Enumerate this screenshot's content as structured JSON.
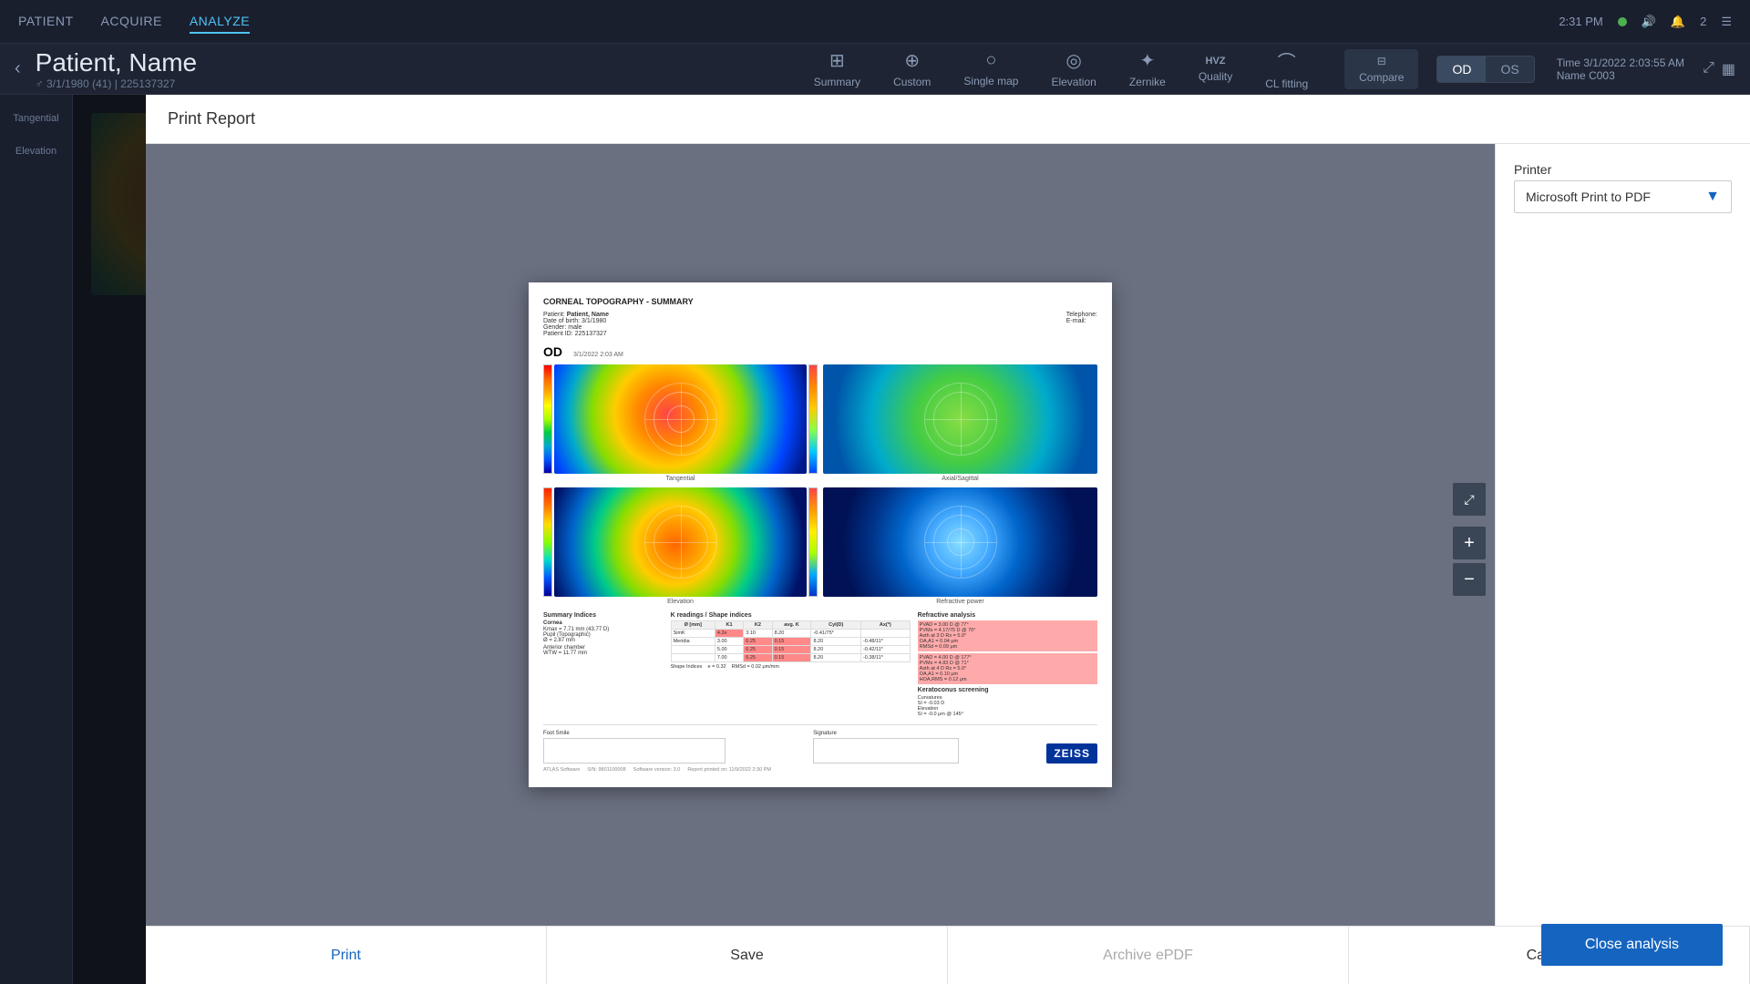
{
  "topNav": {
    "tabs": [
      {
        "label": "PATIENT",
        "active": false
      },
      {
        "label": "ACQUIRE",
        "active": false
      },
      {
        "label": "ANALYZE",
        "active": true
      }
    ],
    "time": "2:31 PM",
    "statusDot": "online",
    "notifCount": "2"
  },
  "toolbar": {
    "backLabel": "‹",
    "patientName": "Patient, Name",
    "patientInfo": "♂ 3/1/1980 (41) | 225137327",
    "tabs": [
      {
        "label": "Summary",
        "icon": "⊞",
        "active": false
      },
      {
        "label": "Custom",
        "icon": "⊕",
        "active": false
      },
      {
        "label": "Single map",
        "icon": "○",
        "active": false
      },
      {
        "label": "Elevation",
        "icon": "◎",
        "active": false
      },
      {
        "label": "Zernike",
        "icon": "✦",
        "active": false
      },
      {
        "label": "Quality",
        "icon": "HVZ",
        "active": false
      },
      {
        "label": "CL fitting",
        "icon": "⌒",
        "active": false
      }
    ],
    "compareLabel": "Compare",
    "odLabel": "OD",
    "osLabel": "OS",
    "time": "Time",
    "timeValue": "3/1/2022 2:03:55 AM",
    "nameLabel": "Name",
    "nameValue": "C003"
  },
  "modal": {
    "title": "Print Report",
    "printerLabel": "Printer",
    "printerValue": "Microsoft Print to PDF",
    "document": {
      "title": "CORNEAL TOPOGRAPHY - SUMMARY",
      "patientLabel": "Patient:",
      "patientName": "Patient, Name",
      "dobLabel": "Date of birth:",
      "dob": "3/1/1980",
      "genderLabel": "Gender:",
      "gender": "male",
      "idLabel": "Patient ID:",
      "id": "225137327",
      "telephoneLabel": "Telephone:",
      "emailLabel": "E-mail:",
      "odLabel": "OD",
      "timestamp": "3/1/2022 2:03 AM",
      "maps": [
        {
          "label": "Tangential",
          "type": "tangential"
        },
        {
          "label": "",
          "type": "small-top"
        },
        {
          "label": "Elevation",
          "type": "elevation"
        },
        {
          "label": "Refractive power",
          "type": "refractive"
        }
      ],
      "summaryTitle": "Summary Indices",
      "cornea": "Cornea",
      "kmax": "Kmax = 7.71 mm (43.77 D)",
      "pupil": "Pupil (Topographic)",
      "pupilVal": "Ø = 2.87 mm",
      "anteriorChamber": "Anterior chamber",
      "wtwLabel": "WTW = 11.77 mm",
      "footSmile": "Foot Smile",
      "signatureLabel": "Signature",
      "atlasLabel": "ATLAS Software",
      "snLabel": "S/N: 9801100008",
      "softwareLabel": "Software version: 3.0",
      "reportLabel": "Report printed on: 11/9/2022 2:30 PM"
    },
    "footer": {
      "printLabel": "Print",
      "saveLabel": "Save",
      "archiveLabel": "Archive ePDF",
      "cancelLabel": "Cancel"
    }
  },
  "closeAnalysis": {
    "label": "Close analysis"
  },
  "sidebar": {
    "items": [
      {
        "label": "Tangential"
      },
      {
        "label": "Elevation"
      }
    ]
  }
}
